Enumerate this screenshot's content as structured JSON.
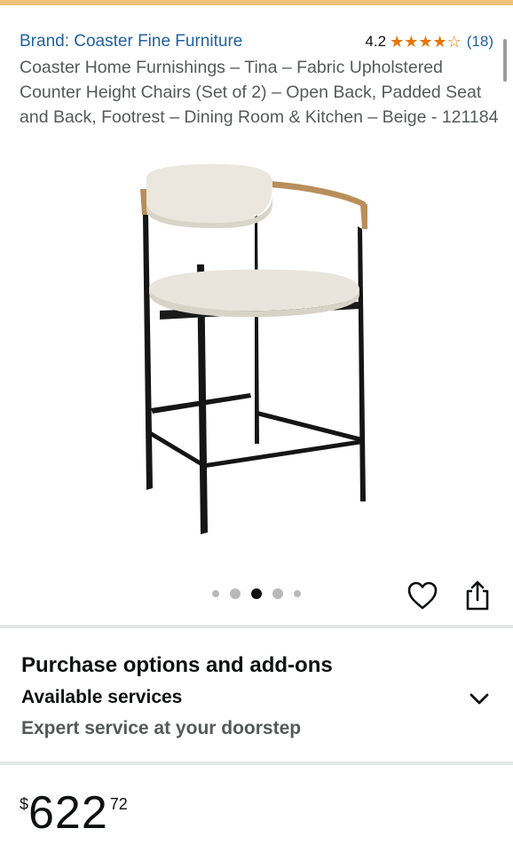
{
  "header": {
    "accent_color": "#f3c27a"
  },
  "product": {
    "brand_link": "Brand: Coaster Fine Furniture",
    "rating_value": "4.2",
    "rating_stars": 4.2,
    "review_count": "(18)",
    "title": "Coaster Home Furnishings – Tina – Fabric Upholstered Counter Height Chairs (Set of 2) – Open Back, Padded Seat and Back, Footrest – Dining Room & Kitchen – Beige - 121184"
  },
  "gallery": {
    "image_count": 5,
    "active_index": 2
  },
  "purchase_options": {
    "heading": "Purchase options and add-ons",
    "subheading": "Available services",
    "description": "Expert service at your doorstep"
  },
  "price": {
    "currency": "$",
    "whole": "622",
    "fraction": "72"
  },
  "colors": {
    "link": "#2162a1",
    "star": "#e77600",
    "muted_text": "#565959"
  }
}
